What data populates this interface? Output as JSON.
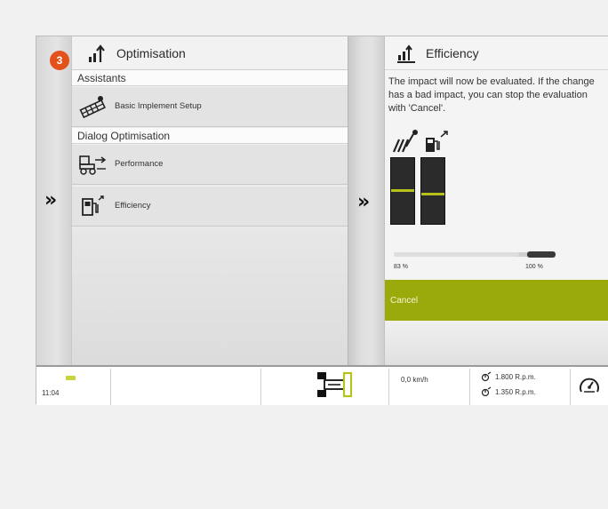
{
  "badge": {
    "number": "3",
    "color": "#e4521b"
  },
  "left_panel": {
    "title": "Optimisation",
    "title_icon": "optimisation-icon",
    "sections": [
      {
        "label": "Assistants"
      },
      {
        "label": "Dialog Optimisation"
      }
    ],
    "items": [
      {
        "label": "Basic Implement Setup",
        "icon": "implement-setup-icon"
      },
      {
        "label": "Performance",
        "icon": "performance-icon"
      },
      {
        "label": "Efficiency",
        "icon": "fuel-efficiency-icon"
      }
    ]
  },
  "navigation": {
    "expand_left": "»",
    "expand_right": "»"
  },
  "right_panel": {
    "title": "Efficiency",
    "title_icon": "efficiency-icon",
    "description": "The impact will now be evaluated. If the change has a bad impact, you can stop the evaluation with 'Cancel'.",
    "bars": [
      {
        "icon": "work-rate-icon",
        "level": 0.53
      },
      {
        "icon": "fuel-consumption-icon",
        "level": 0.47
      }
    ],
    "progress": {
      "start_label": "83 %",
      "end_label": "100 %"
    },
    "cancel_label": "Cancel"
  },
  "status_bar": {
    "time": "11:04",
    "speed": "0,0 km/h",
    "rpm_1": "1.800 R.p.m.",
    "rpm_2": "1.350 R.p.m.",
    "tractor_icon": "tractor-icon",
    "gauge_icon": "speedometer-icon"
  },
  "colors": {
    "accent": "#9aaa0b",
    "bar_marker": "#b7c31a",
    "status_led": "#c9d33a"
  }
}
